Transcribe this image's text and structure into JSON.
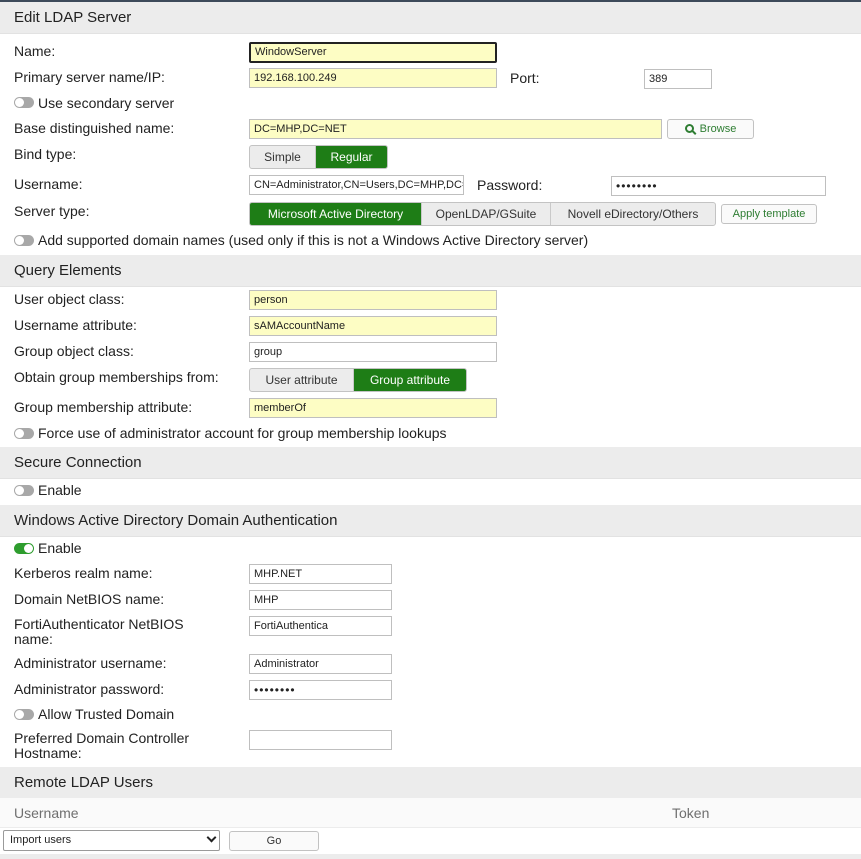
{
  "sections": {
    "edit": "Edit LDAP Server",
    "query": "Query Elements",
    "secure": "Secure Connection",
    "windows": "Windows Active Directory Domain Authentication",
    "remote": "Remote LDAP Users"
  },
  "server": {
    "name_label": "Name:",
    "name_value": "WindowServer",
    "primary_label": "Primary server name/IP:",
    "primary_value": "192.168.100.249",
    "port_label": "Port:",
    "port_value": "389",
    "secondary_label": "Use secondary server",
    "basedn_label": "Base distinguished name:",
    "basedn_value": "DC=MHP,DC=NET",
    "browse_label": "Browse",
    "bind_label": "Bind type:",
    "bind_options": [
      "Simple",
      "Regular"
    ],
    "username_label": "Username:",
    "username_value": "CN=Administrator,CN=Users,DC=MHP,DC=NET",
    "password_label": "Password:",
    "password_value": "••••••••",
    "servertype_label": "Server type:",
    "servertype_options": [
      "Microsoft Active Directory",
      "OpenLDAP/GSuite",
      "Novell eDirectory/Others"
    ],
    "apply_label": "Apply template",
    "domains_label": "Add supported domain names (used only if this is not a Windows Active Directory server)"
  },
  "query": {
    "user_class_label": "User object class:",
    "user_class_value": "person",
    "username_attr_label": "Username attribute:",
    "username_attr_value": "sAMAccountName",
    "group_class_label": "Group object class:",
    "group_class_value": "group",
    "obtain_label": "Obtain group memberships from:",
    "obtain_options": [
      "User attribute",
      "Group attribute"
    ],
    "membership_attr_label": "Group membership attribute:",
    "membership_attr_value": "memberOf",
    "force_admin_label": "Force use of administrator account for group membership lookups"
  },
  "secure": {
    "enable_label": "Enable"
  },
  "windows": {
    "enable_label": "Enable",
    "realm_label": "Kerberos realm name:",
    "realm_value": "MHP.NET",
    "netbios_label": "Domain NetBIOS name:",
    "netbios_value": "MHP",
    "fa_netbios_label": "FortiAuthenticator NetBIOS name:",
    "fa_netbios_value": "FortiAuthentica",
    "admin_user_label": "Administrator username:",
    "admin_user_value": "Administrator",
    "admin_pass_label": "Administrator password:",
    "admin_pass_value": "••••••••",
    "trusted_label": "Allow Trusted Domain",
    "dc_label": "Preferred Domain Controller Hostname:",
    "dc_value": ""
  },
  "remote": {
    "col_username": "Username",
    "col_token": "Token",
    "action_select": "Import users",
    "go_label": "Go"
  },
  "colors": {
    "accent_green": "#1e7d16",
    "input_yellow": "#fdfdc4",
    "header_gray": "#ececec"
  }
}
